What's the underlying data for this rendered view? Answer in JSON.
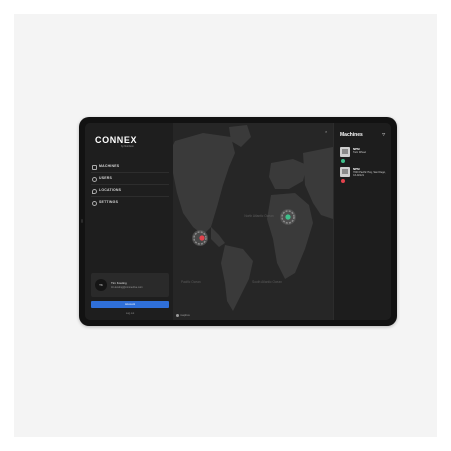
{
  "brand": {
    "logo": "CONNEX",
    "sub": "by Nordson"
  },
  "sidebar": {
    "items": [
      {
        "label": "MACHINES",
        "icon": "machine-icon"
      },
      {
        "label": "USERS",
        "icon": "user-icon"
      },
      {
        "label": "LOCATIONS",
        "icon": "location-icon"
      },
      {
        "label": "SETTINGS",
        "icon": "gear-icon"
      }
    ],
    "user": {
      "initials": "TK",
      "name": "Tim Kosting",
      "email": "tim.kosting@connexlive.com"
    },
    "account_label": "Account",
    "logout_label": "Log out"
  },
  "map": {
    "labels": [
      "North Atlantic Ocean",
      "South Atlantic Ocean",
      "Pacific Ocean"
    ],
    "mapbox_label": "mapbox",
    "clusters": [
      {
        "status": "warning",
        "color": "#e2424c"
      },
      {
        "status": "ok",
        "color": "#3fbf8b"
      }
    ]
  },
  "panel": {
    "title": "Machines",
    "machines": [
      {
        "name": "NPM",
        "location": "Twin Wheel",
        "status_color": "#3fbf8b"
      },
      {
        "name": "NPM",
        "location": "7000 Pacific Hwy, San Diego, CA 92121",
        "status_color": "#e2424c"
      }
    ]
  },
  "colors": {
    "accent": "#2f6fd8",
    "ok": "#3fbf8b",
    "warning": "#e2424c"
  }
}
